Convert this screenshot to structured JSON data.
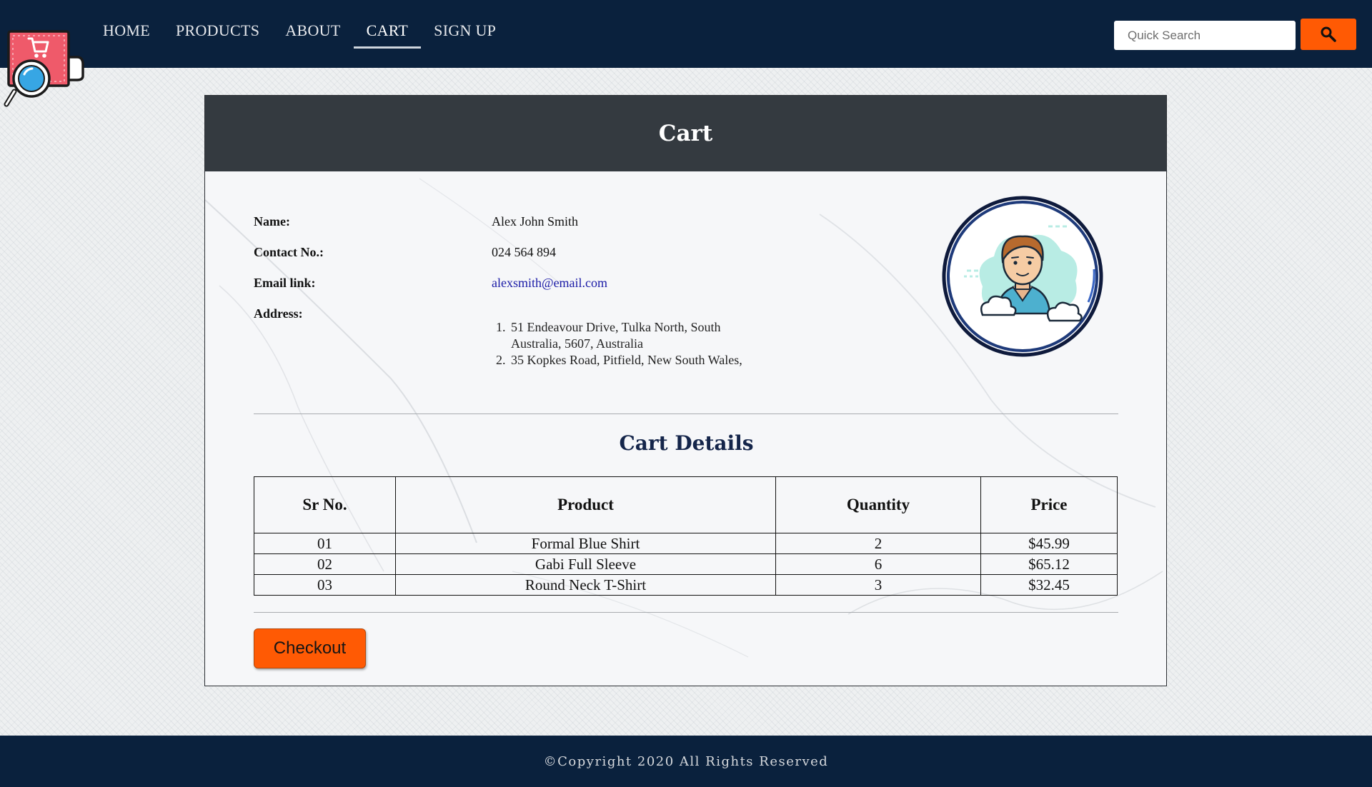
{
  "nav": {
    "items": [
      {
        "label": "HOME",
        "active": false
      },
      {
        "label": "PRODUCTS",
        "active": false
      },
      {
        "label": "ABOUT",
        "active": false
      },
      {
        "label": "CART",
        "active": true
      },
      {
        "label": "SIGN UP",
        "active": false
      }
    ],
    "search_placeholder": "Quick Search",
    "search_icon": "search-icon",
    "accent_color": "#ff5a04",
    "bar_color": "#0a213d"
  },
  "card": {
    "title": "Cart",
    "profile": {
      "name_label": "Name:",
      "name": "Alex John Smith",
      "contact_label": "Contact No.:",
      "contact": "024 564 894",
      "email_label": "Email link:",
      "email": "alexsmith@email.com",
      "address_label": "Address:",
      "addresses": [
        "51 Endeavour Drive, Tulka North, South Australia, 5607, Australia",
        "35 Kopkes Road, Pitfield, New South Wales,"
      ],
      "avatar_icon": "user-avatar-icon"
    },
    "details_title": "Cart Details",
    "table": {
      "headers": [
        "Sr No.",
        "Product",
        "Quantity",
        "Price"
      ],
      "rows": [
        [
          "01",
          "Formal Blue Shirt",
          "2",
          "$45.99"
        ],
        [
          "02",
          "Gabi Full Sleeve",
          "6",
          "$65.12"
        ],
        [
          "03",
          "Round Neck T-Shirt",
          "3",
          "$32.45"
        ]
      ]
    },
    "checkout_label": "Checkout"
  },
  "footer": {
    "text": "©Copyright 2020 All Rights Reserved"
  }
}
